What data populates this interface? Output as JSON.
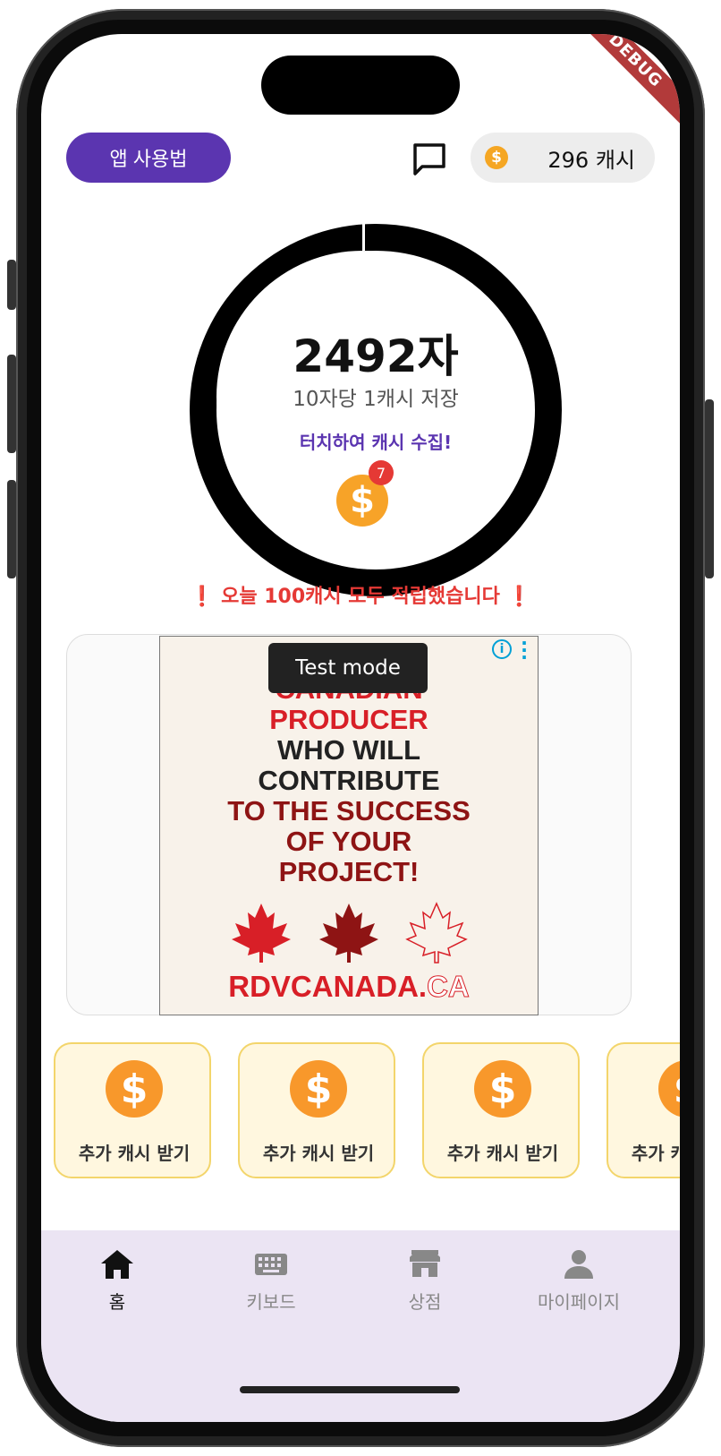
{
  "header": {
    "howto_label": "앱 사용법",
    "cash_balance": "296 캐시",
    "coin_symbol": "$",
    "debug_label": "DEBUG"
  },
  "counter": {
    "count": "2492자",
    "rate": "10자당 1캐시 저장",
    "touch_label": "터치하여 캐시 수집!",
    "coin_badge": "7",
    "progress": 1.0
  },
  "notice": "❗  오늘 100캐시 모두 적립했습니다  ❗",
  "ad": {
    "test_mode_label": "Test mode",
    "info_symbol": "i",
    "lines": [
      {
        "text": "CANADIAN",
        "tone": "red"
      },
      {
        "text": "PRODUCER",
        "tone": "red"
      },
      {
        "text": "WHO WILL",
        "tone": "dark"
      },
      {
        "text": "CONTRIBUTE",
        "tone": "dark"
      },
      {
        "text": "TO THE SUCCESS",
        "tone": "maroon"
      },
      {
        "text": "OF YOUR",
        "tone": "maroon"
      },
      {
        "text": "PROJECT!",
        "tone": "maroon"
      }
    ],
    "site_main": "RDVCANADA",
    "site_dot": ".",
    "site_tld": "CA"
  },
  "bonus_cards": [
    {
      "label": "추가 캐시 받기"
    },
    {
      "label": "추가 캐시 받기"
    },
    {
      "label": "추가 캐시 받기"
    },
    {
      "label": "추가 캐시 받기"
    }
  ],
  "nav": {
    "items": [
      {
        "label": "홈",
        "icon": "home-icon",
        "active": true
      },
      {
        "label": "키보드",
        "icon": "keyboard-icon",
        "active": false
      },
      {
        "label": "상점",
        "icon": "store-icon",
        "active": false
      },
      {
        "label": "마이페이지",
        "icon": "person-icon",
        "active": false
      }
    ]
  },
  "colors": {
    "accent": "#5b35b0",
    "coin": "#f7a328",
    "alert": "#e53935",
    "nav_bg": "#ebe4f3"
  }
}
